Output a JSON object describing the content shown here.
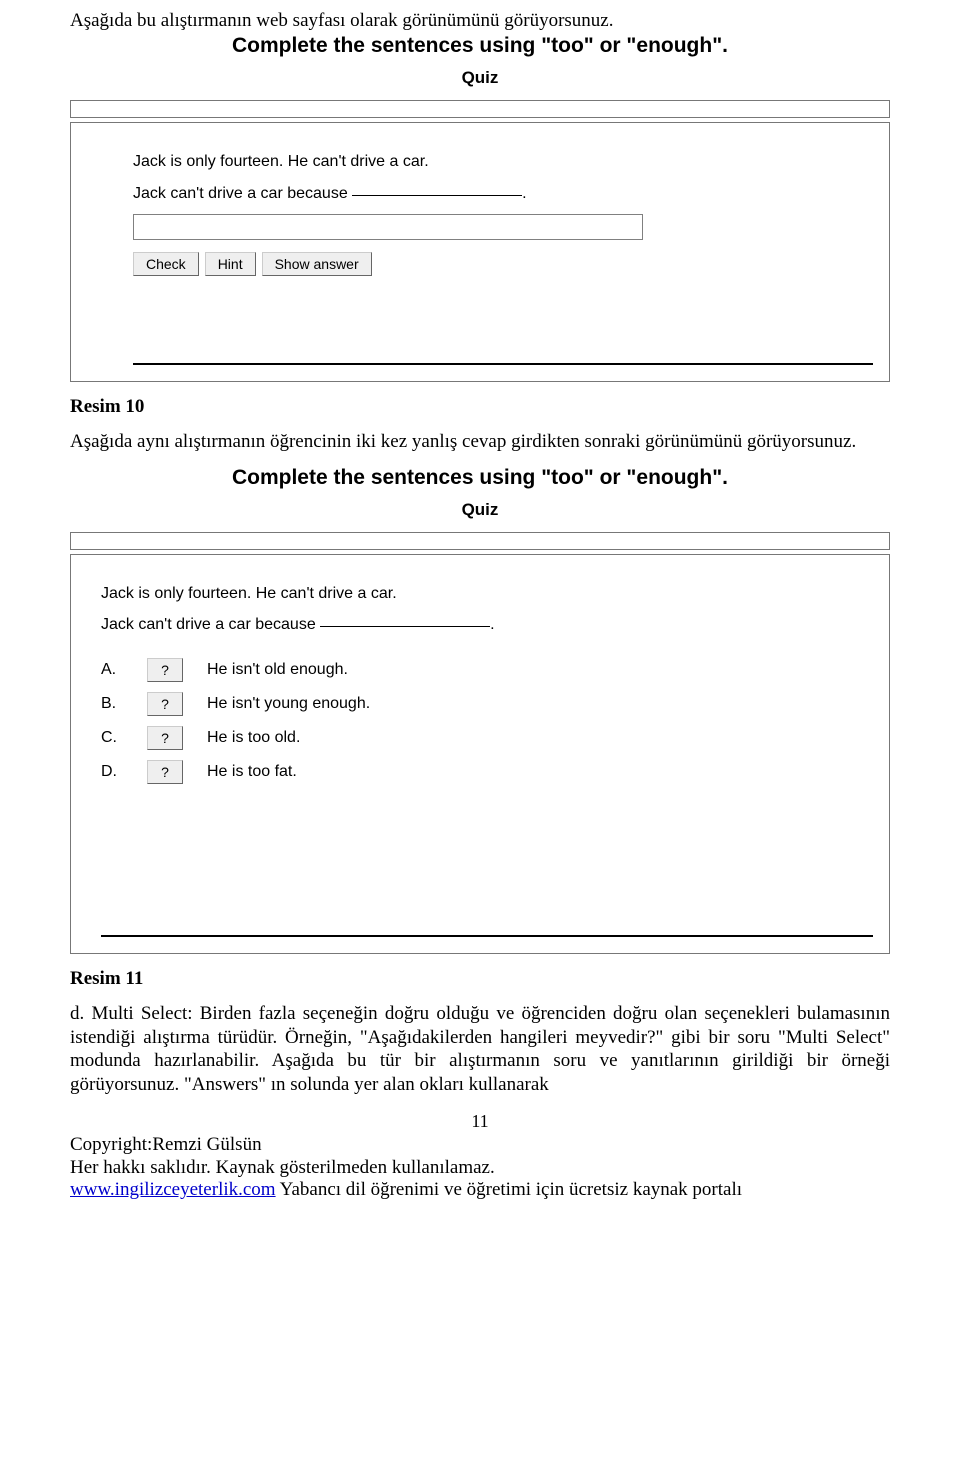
{
  "intro1": "Aşağıda bu alıştırmanın  web sayfası olarak görünümünü görüyorsunuz.",
  "quiz": {
    "title": "Complete the sentences using \"too\" or \"enough\".",
    "subtitle": "Quiz",
    "question_line1": "Jack is only fourteen. He can't drive a car.",
    "question_line2": "Jack can't drive a car because ",
    "buttons": {
      "check": "Check",
      "hint": "Hint",
      "show": "Show answer"
    }
  },
  "caption1": "Resim 10",
  "mid_para": "Aşağıda aynı alıştırmanın öğrencinin iki kez yanlış cevap girdikten sonraki görünümünü görüyorsunuz.",
  "options": [
    {
      "label": "A.",
      "btn": "?",
      "text": "He isn't old enough."
    },
    {
      "label": "B.",
      "btn": "?",
      "text": "He isn't young enough."
    },
    {
      "label": "C.",
      "btn": "?",
      "text": "He is too old."
    },
    {
      "label": "D.",
      "btn": "?",
      "text": "He is too fat."
    }
  ],
  "caption2": "Resim 11",
  "body_d": "d. Multi Select: Birden fazla seçeneğin doğru olduğu ve öğrenciden doğru olan seçenekleri bulamasının istendiği alıştırma türüdür. Örneğin, \"Aşağıdakilerden hangileri meyvedir?\" gibi bir soru \"Multi Select\" modunda hazırlanabilir. Aşağıda bu tür bir alıştırmanın soru ve yanıtlarının girildiği bir örneği görüyorsunuz. \"Answers\" ın solunda yer alan okları kullanarak",
  "page_number": "11",
  "footer": {
    "l1": "Copyright:Remzi Gülsün",
    "l2": "Her hakkı saklıdır. Kaynak gösterilmeden kullanılamaz.",
    "link": "www.ingilizceyeterlik.com",
    "l3_tail": " Yabancı dil öğrenimi ve öğretimi için ücretsiz kaynak portalı"
  }
}
